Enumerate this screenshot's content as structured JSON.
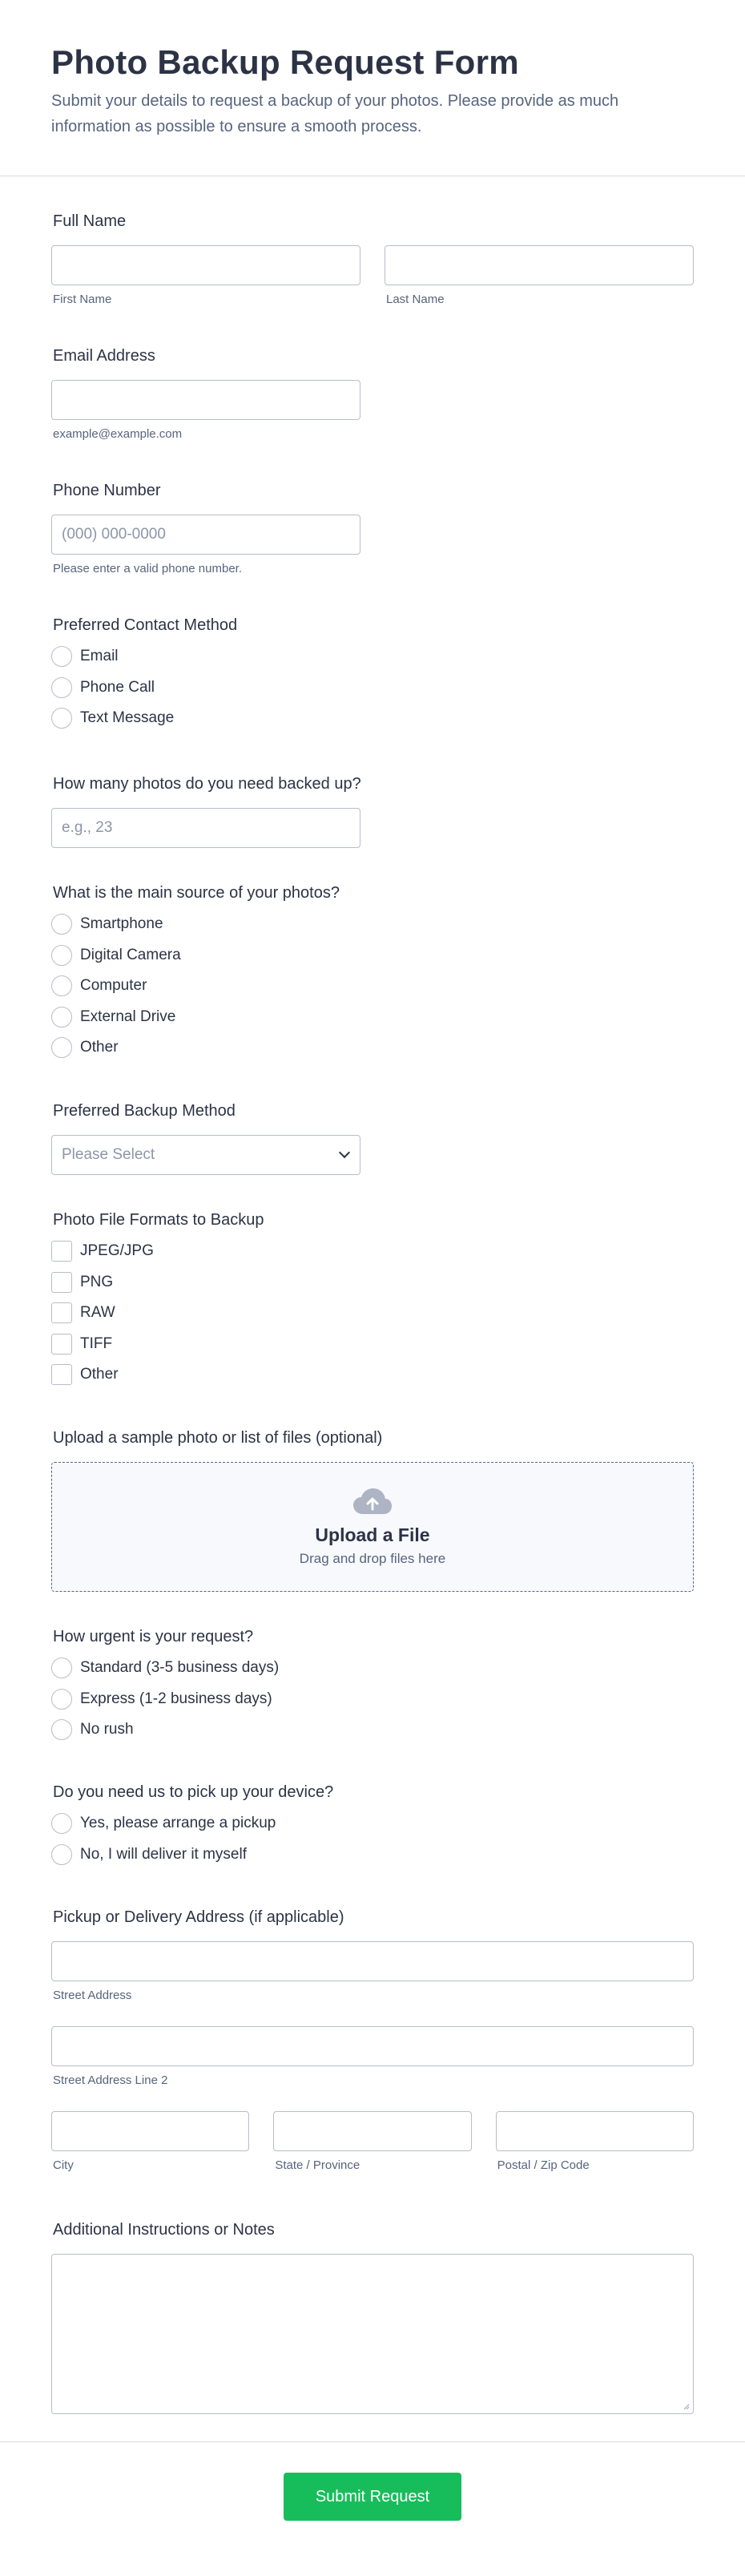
{
  "header": {
    "title": "Photo Backup Request Form",
    "description": "Submit your details to request a backup of your photos. Please provide as much information as possible to ensure a smooth process."
  },
  "full_name": {
    "label": "Full Name",
    "first_sub": "First Name",
    "last_sub": "Last Name"
  },
  "email": {
    "label": "Email Address",
    "sub": "example@example.com"
  },
  "phone": {
    "label": "Phone Number",
    "placeholder": "(000) 000-0000",
    "sub": "Please enter a valid phone number."
  },
  "contact_method": {
    "label": "Preferred Contact Method",
    "options": [
      "Email",
      "Phone Call",
      "Text Message"
    ]
  },
  "photo_count": {
    "label": "How many photos do you need backed up?",
    "placeholder": "e.g., 23"
  },
  "source": {
    "label": "What is the main source of your photos?",
    "options": [
      "Smartphone",
      "Digital Camera",
      "Computer",
      "External Drive",
      "Other"
    ]
  },
  "backup_method": {
    "label": "Preferred Backup Method",
    "placeholder": "Please Select"
  },
  "formats": {
    "label": "Photo File Formats to Backup",
    "options": [
      "JPEG/JPG",
      "PNG",
      "RAW",
      "TIFF",
      "Other"
    ]
  },
  "upload": {
    "label": "Upload a sample photo or list of files (optional)",
    "title": "Upload a File",
    "subtitle": "Drag and drop files here",
    "icon": "cloud-upload-icon"
  },
  "urgency": {
    "label": "How urgent is your request?",
    "options": [
      "Standard (3-5 business days)",
      "Express (1-2 business days)",
      "No rush"
    ]
  },
  "pickup": {
    "label": "Do you need us to pick up your device?",
    "options": [
      "Yes, please arrange a pickup",
      "No, I will deliver it myself"
    ]
  },
  "address": {
    "label": "Pickup or Delivery Address (if applicable)",
    "street_sub": "Street Address",
    "street2_sub": "Street Address Line 2",
    "city_sub": "City",
    "state_sub": "State / Province",
    "zip_sub": "Postal / Zip Code"
  },
  "notes": {
    "label": "Additional Instructions or Notes"
  },
  "submit": {
    "label": "Submit Request"
  },
  "colors": {
    "submit_bg": "#18bd5b",
    "text": "#2c3345",
    "muted": "#57647e",
    "border": "#b8bdc9"
  }
}
